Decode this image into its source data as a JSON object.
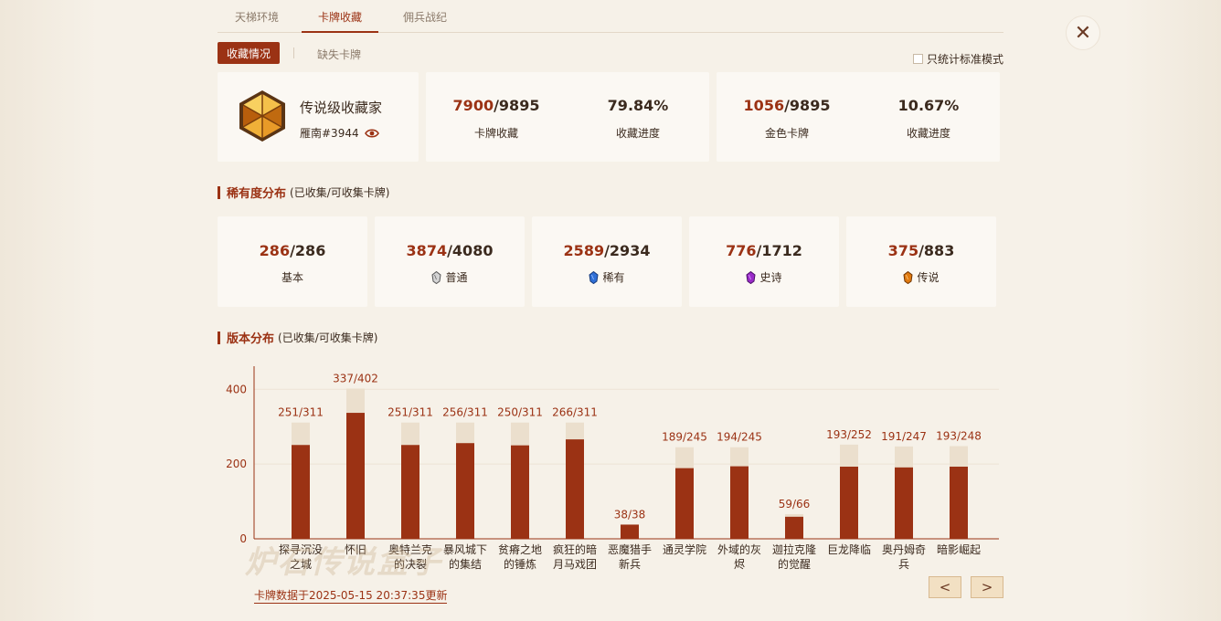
{
  "top_tabs": [
    {
      "label": "天梯环境",
      "active": false
    },
    {
      "label": "卡牌收藏",
      "active": true
    },
    {
      "label": "佣兵战纪",
      "active": false
    }
  ],
  "sub_tabs": {
    "active": "收藏情况",
    "other": "缺失卡牌"
  },
  "standard_only_label": "只统计标准模式",
  "profile": {
    "title": "传说级收藏家",
    "id": "雁南#3944"
  },
  "stats": {
    "cards": {
      "owned": "7900",
      "total": "/9895",
      "label": "卡牌收藏",
      "progress": "79.84%",
      "progress_label": "收藏进度"
    },
    "golden": {
      "owned": "1056",
      "total": "/9895",
      "label": "金色卡牌",
      "progress": "10.67%",
      "progress_label": "收藏进度"
    }
  },
  "rarity_section": {
    "title": "稀有度分布",
    "sub": "(已收集/可收集卡牌)"
  },
  "rarity": [
    {
      "owned": "286",
      "total": "/286",
      "label": "基本",
      "gem": "none"
    },
    {
      "owned": "3874",
      "total": "/4080",
      "label": "普通",
      "gem": "common-gem-icon"
    },
    {
      "owned": "2589",
      "total": "/2934",
      "label": "稀有",
      "gem": "rare-gem-icon"
    },
    {
      "owned": "776",
      "total": "/1712",
      "label": "史诗",
      "gem": "epic-gem-icon"
    },
    {
      "owned": "375",
      "total": "/883",
      "label": "传说",
      "gem": "legendary-gem-icon"
    }
  ],
  "gem_colors": {
    "common": "#c8c8c8",
    "rare": "#2f6fd6",
    "epic": "#9a2bc9",
    "legendary": "#e07a10"
  },
  "version_section": {
    "title": "版本分布",
    "sub": "(已收集/可收集卡牌)"
  },
  "chart_data": {
    "type": "bar",
    "categories": [
      [
        "探寻沉没",
        "之城"
      ],
      [
        "怀旧"
      ],
      [
        "奥特兰克",
        "的决裂"
      ],
      [
        "暴风城下",
        "的集结"
      ],
      [
        "贫瘠之地",
        "的锤炼"
      ],
      [
        "疯狂的暗",
        "月马戏团"
      ],
      [
        "恶魔猎手",
        "新兵"
      ],
      [
        "通灵学院"
      ],
      [
        "外域的灰",
        "烬"
      ],
      [
        "迦拉克隆",
        "的觉醒"
      ],
      [
        "巨龙降临"
      ],
      [
        "奥丹姆奇",
        "兵"
      ],
      [
        "暗影崛起"
      ]
    ],
    "series": [
      {
        "values": [
          251,
          337,
          251,
          256,
          250,
          266,
          38,
          189,
          194,
          59,
          193,
          191,
          193
        ]
      },
      {
        "values": [
          311,
          402,
          311,
          311,
          311,
          311,
          38,
          245,
          245,
          66,
          252,
          247,
          248
        ]
      }
    ],
    "data_labels": [
      "251/311",
      "337/402",
      "251/311",
      "256/311",
      "250/311",
      "266/311",
      "38/38",
      "189/245",
      "194/245",
      "59/66",
      "193/252",
      "191/247",
      "193/248"
    ],
    "yticks": [
      "400",
      "200",
      "0"
    ],
    "ylim": [
      0,
      430
    ],
    "colors": {
      "owned": "#9b3214",
      "total": "#ebdfcd",
      "axis": "#9b3214",
      "grid": "#ede3d5"
    },
    "grid": true
  },
  "nav": {
    "prev": "<",
    "next": ">"
  },
  "watermark": "炉石传说盒子",
  "update_note": "卡牌数据于2025-05-15 20:37:35更新"
}
